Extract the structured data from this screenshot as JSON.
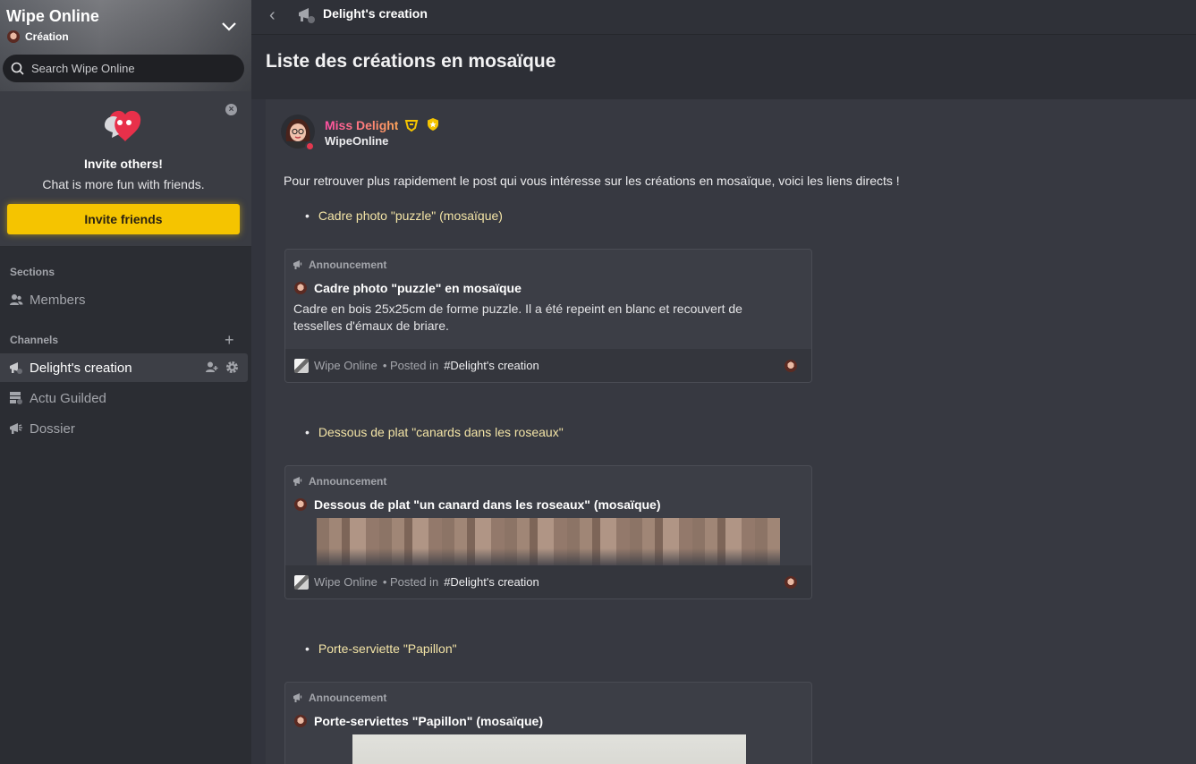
{
  "server": {
    "name": "Wipe Online",
    "subtitle": "Création",
    "search_placeholder": "Search Wipe Online"
  },
  "invite": {
    "heading": "Invite others!",
    "text": "Chat is more fun with friends.",
    "button": "Invite friends",
    "close": "×"
  },
  "sections": {
    "label": "Sections",
    "members": "Members"
  },
  "channels": {
    "label": "Channels",
    "add": "+",
    "items": [
      {
        "label": "Delight's creation",
        "active": true
      },
      {
        "label": "Actu Guilded"
      },
      {
        "label": "Dossier"
      }
    ]
  },
  "topbar": {
    "back": "‹",
    "title": "Delight's creation"
  },
  "page": {
    "title": "Liste des créations en mosaïque"
  },
  "post": {
    "author": "Miss Delight",
    "author_sub": "WipeOnline",
    "intro": "Pour retrouver plus rapidement le post qui vous intéresse sur les créations en mosaïque, voici les liens directs !",
    "items": [
      {
        "bullet": "Cadre photo \"puzzle\" (mosaïque)",
        "card": {
          "kind": "Announcement",
          "title": "Cadre photo \"puzzle\" en mosaïque",
          "desc": "Cadre en bois 25x25cm de forme puzzle. Il a été repeint en blanc et recouvert de tesselles d'émaux de briare.",
          "server": "Wipe Online",
          "posted_in": "• Posted in",
          "channel": "#Delight's creation"
        }
      },
      {
        "bullet": "Dessous de plat \"canards dans les roseaux\"",
        "card": {
          "kind": "Announcement",
          "title": "Dessous de plat \"un canard dans les roseaux\" (mosaïque)",
          "server": "Wipe Online",
          "posted_in": "• Posted in",
          "channel": "#Delight's creation"
        }
      },
      {
        "bullet": "Porte-serviette \"Papillon\"",
        "card": {
          "kind": "Announcement",
          "title": "Porte-serviettes \"Papillon\" (mosaïque)"
        }
      }
    ]
  },
  "colors": {
    "accent_yellow": "#f5c400",
    "link_yellow": "#f3e4a6",
    "status_red": "#e2384f"
  }
}
